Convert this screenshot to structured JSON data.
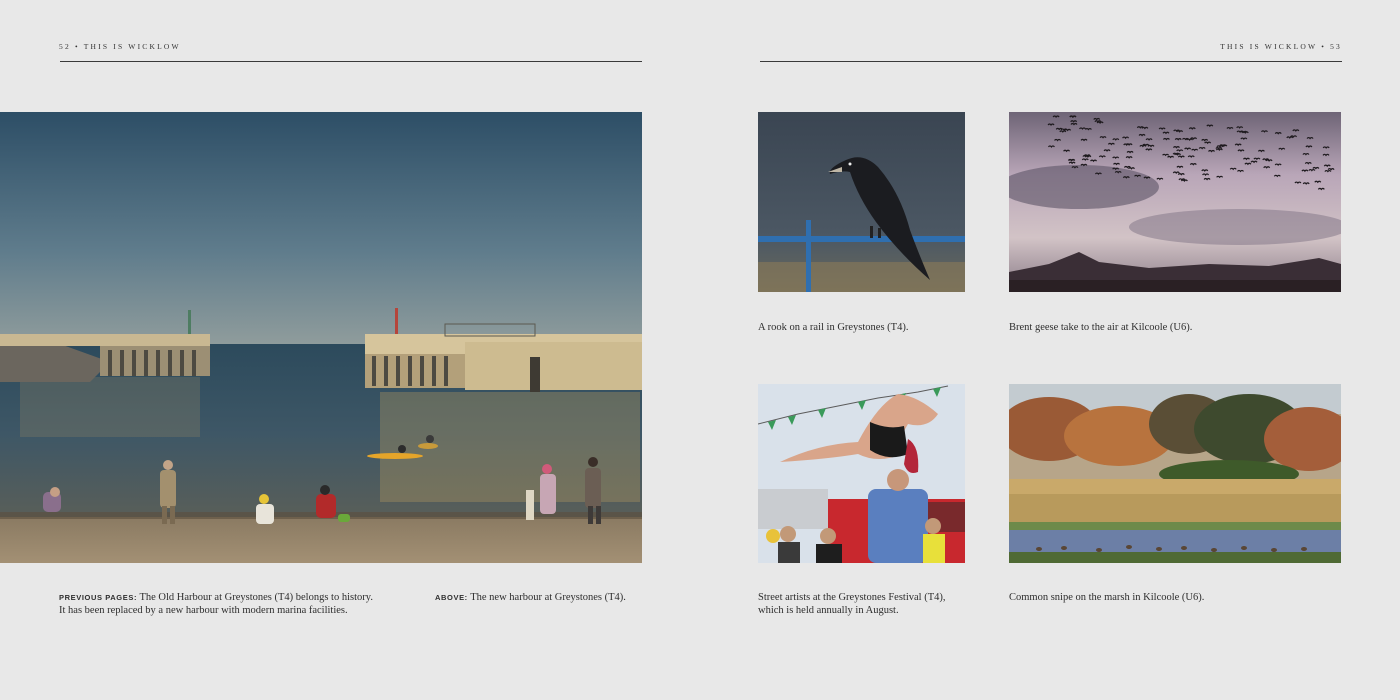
{
  "left_page": {
    "running_head": "52 • This is Wicklow",
    "caption_previous": {
      "label": "Previous pages:",
      "text_line1": " The Old Harbour at Greystones (T4) belongs to history.",
      "text_line2": "It has been replaced by a new harbour with modern marina facilities."
    },
    "caption_above": {
      "label": "Above:",
      "text": " The new harbour at Greystones (T4)."
    }
  },
  "right_page": {
    "running_head": "This is Wicklow • 53",
    "captions": {
      "rook": "A rook on a rail in Greystones (T4).",
      "geese": "Brent geese take to the air at Kilcoole (U6).",
      "artists_line1": "Street artists at the Greystones Festival (T4),",
      "artists_line2": "which is held annually in August.",
      "snipe": "Common snipe on the marsh in Kilcoole (U6)."
    }
  },
  "colors": {
    "page_background": "#e8e8e8",
    "rule": "#3a3a3a",
    "text": "#2e2e2e"
  }
}
